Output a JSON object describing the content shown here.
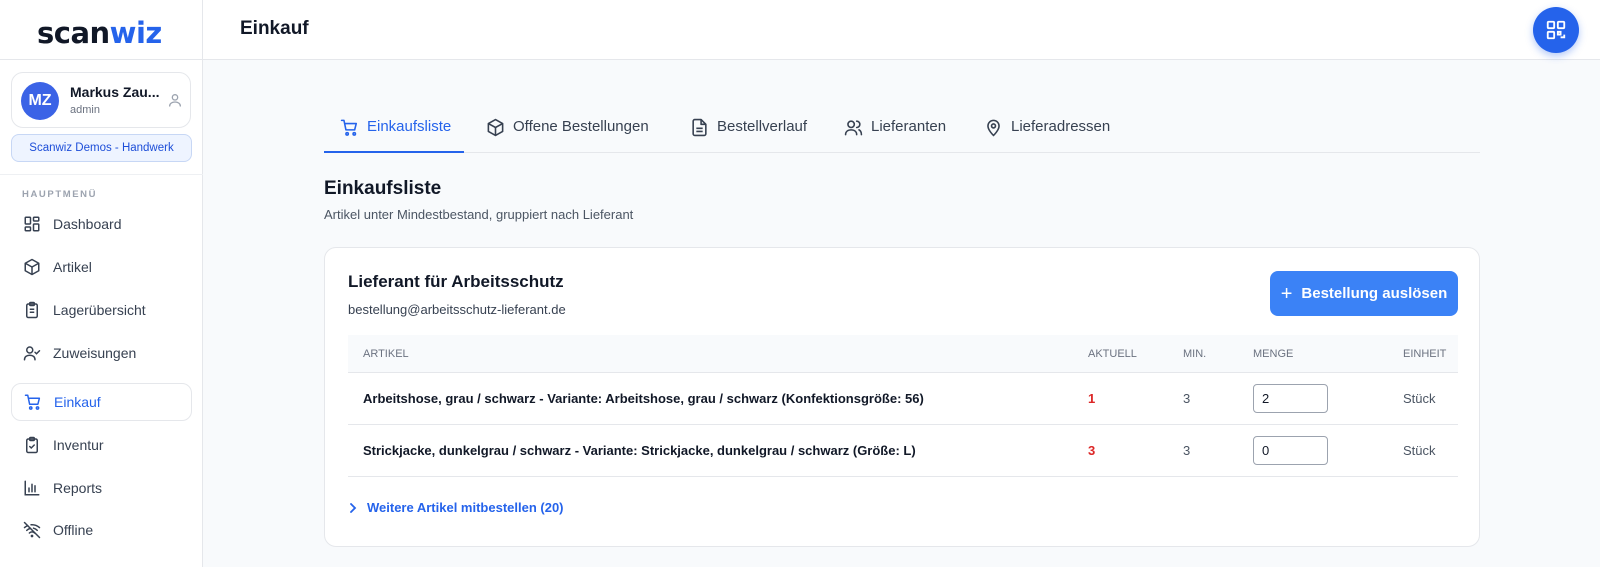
{
  "brand": {
    "logo_part1": "scan",
    "logo_part2": "wiz"
  },
  "user": {
    "initials": "MZ",
    "name": "Markus Zau...",
    "role": "admin",
    "organization": "Scanwiz Demos - Handwerk"
  },
  "sidebar": {
    "heading": "HAUPTMENÜ",
    "items": [
      {
        "label": "Dashboard",
        "icon": "dashboard-icon"
      },
      {
        "label": "Artikel",
        "icon": "package-icon"
      },
      {
        "label": "Lagerübersicht",
        "icon": "clipboard-icon"
      },
      {
        "label": "Zuweisungen",
        "icon": "user-check-icon"
      },
      {
        "label": "Einkauf",
        "icon": "cart-icon",
        "active": true
      },
      {
        "label": "Inventur",
        "icon": "clipboard-check-icon"
      },
      {
        "label": "Reports",
        "icon": "bar-chart-icon"
      },
      {
        "label": "Offline",
        "icon": "wifi-off-icon"
      }
    ]
  },
  "header": {
    "title": "Einkauf",
    "qr_button_icon": "qr-code-icon"
  },
  "tabs": [
    {
      "label": "Einkaufsliste",
      "icon": "cart-icon",
      "active": true
    },
    {
      "label": "Offene Bestellungen",
      "icon": "package-icon"
    },
    {
      "label": "Bestellverlauf",
      "icon": "document-icon"
    },
    {
      "label": "Lieferanten",
      "icon": "users-icon"
    },
    {
      "label": "Lieferadressen",
      "icon": "map-pin-icon"
    }
  ],
  "section": {
    "title": "Einkaufsliste",
    "subtitle": "Artikel unter Mindestbestand, gruppiert nach Lieferant"
  },
  "supplier": {
    "name": "Lieferant für Arbeitsschutz",
    "email": "bestellung@arbeitsschutz-lieferant.de",
    "order_button": "Bestellung auslösen",
    "columns": {
      "article": "ARTIKEL",
      "current": "AKTUELL",
      "min": "MIN.",
      "quantity": "MENGE",
      "unit": "EINHEIT"
    },
    "rows": [
      {
        "article": "Arbeitshose, grau / schwarz - Variante: Arbeitshose, grau / schwarz (Konfektionsgröße: 56)",
        "current": "1",
        "min": "3",
        "quantity": "2",
        "unit": "Stück"
      },
      {
        "article": "Strickjacke, dunkelgrau / schwarz - Variante: Strickjacke, dunkelgrau / schwarz (Größe: L)",
        "current": "3",
        "min": "3",
        "quantity": "0",
        "unit": "Stück"
      }
    ],
    "more_link": "Weitere Artikel mitbestellen (20)"
  },
  "colors": {
    "accent": "#2563eb",
    "button": "#3b82f6",
    "danger": "#dc2626"
  }
}
